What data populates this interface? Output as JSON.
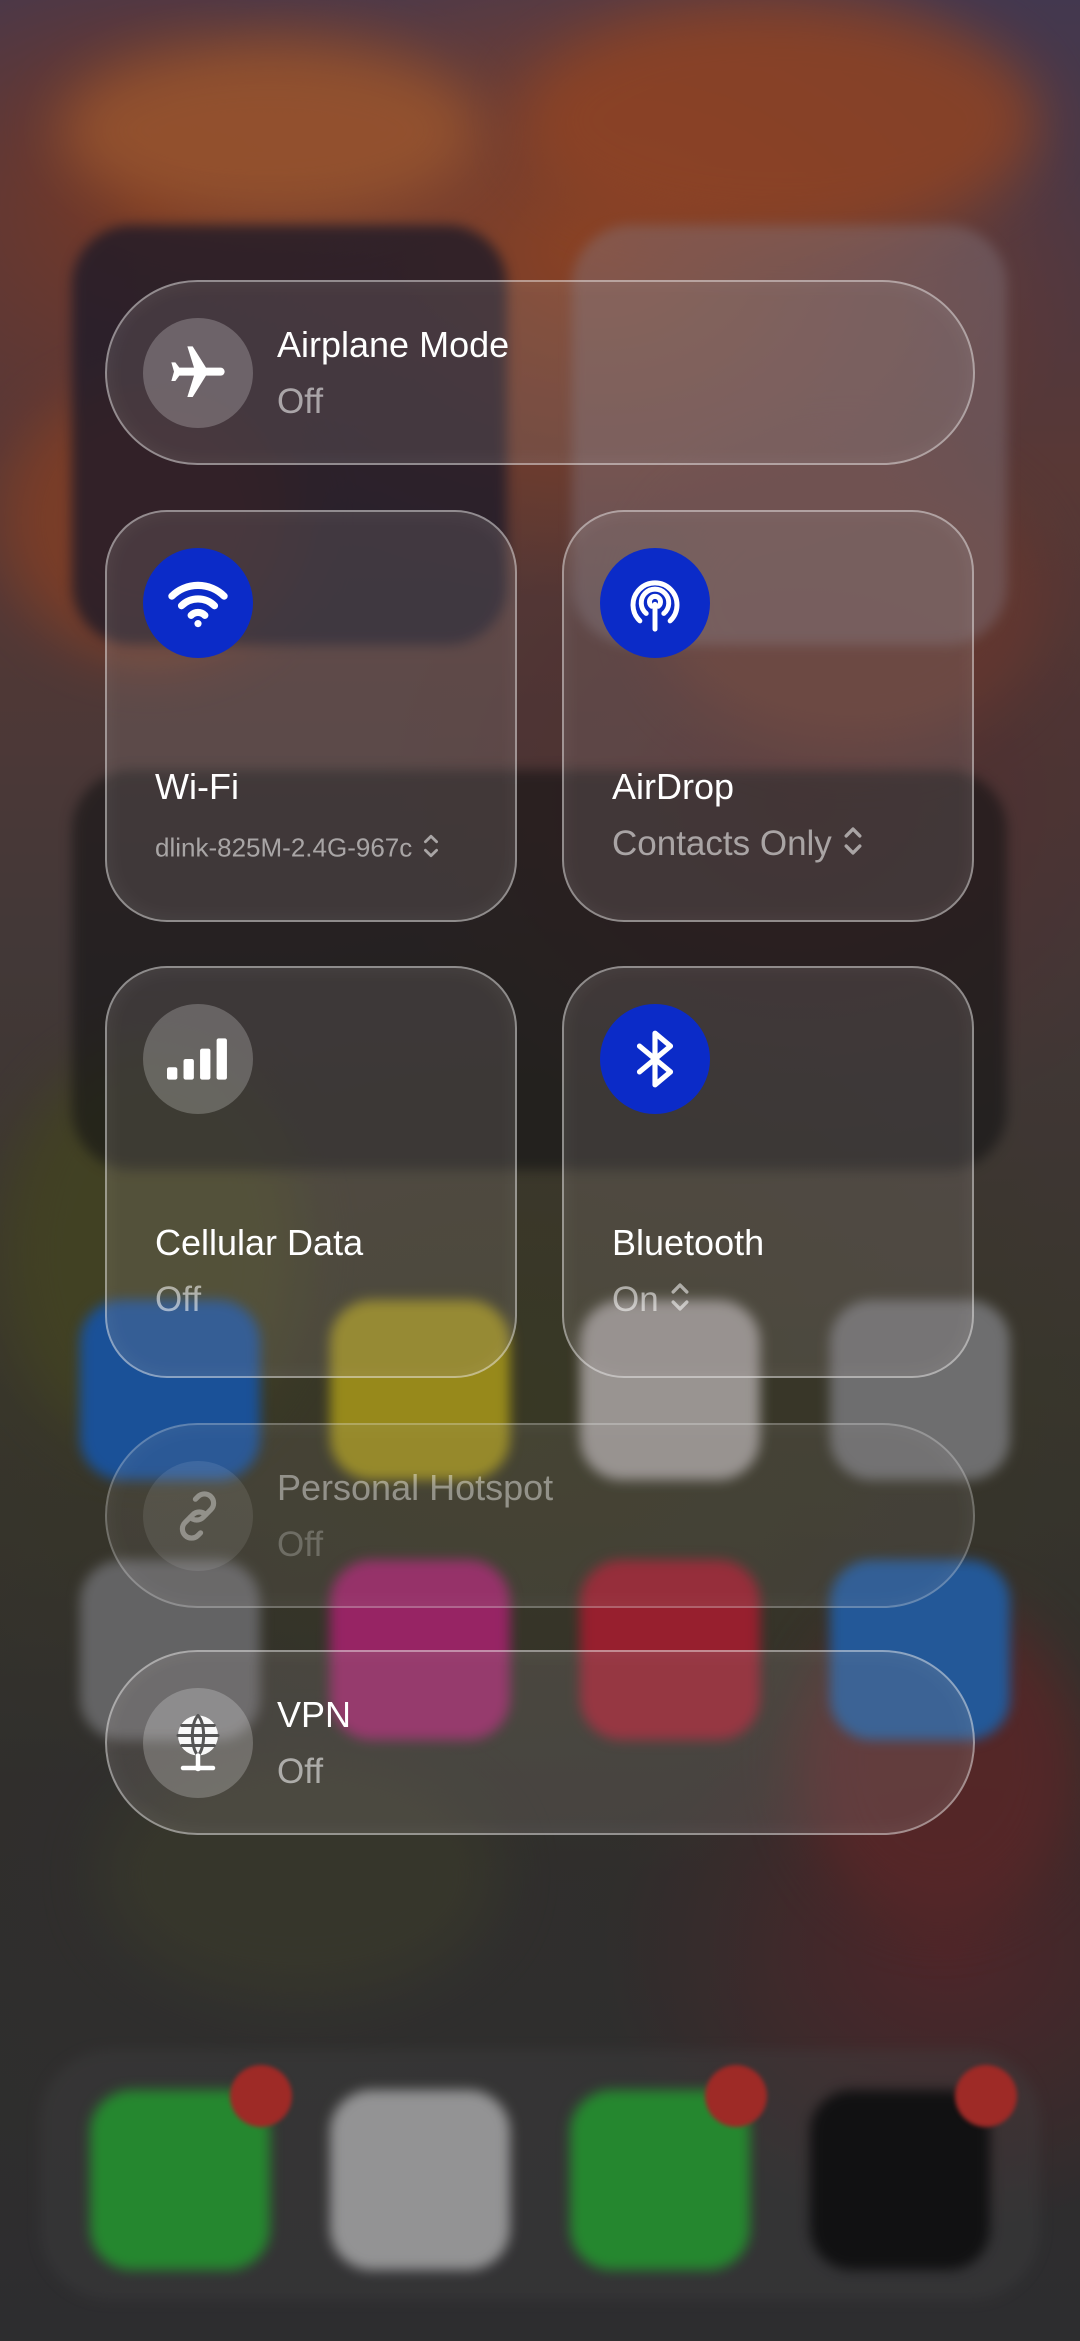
{
  "controls": {
    "airplane_mode": {
      "title": "Airplane Mode",
      "status": "Off",
      "icon": "airplane-icon"
    },
    "wifi": {
      "title": "Wi-Fi",
      "network": "dlink-825M-2.4G-967c",
      "icon": "wifi-icon",
      "active": true
    },
    "airdrop": {
      "title": "AirDrop",
      "status": "Contacts Only",
      "icon": "airdrop-icon",
      "active": true
    },
    "cellular": {
      "title": "Cellular Data",
      "status": "Off",
      "icon": "cellular-signal-icon"
    },
    "bluetooth": {
      "title": "Bluetooth",
      "status": "On",
      "icon": "bluetooth-icon",
      "active": true
    },
    "hotspot": {
      "title": "Personal Hotspot",
      "status": "Off",
      "icon": "hotspot-link-icon",
      "disabled": true
    },
    "vpn": {
      "title": "VPN",
      "status": "Off",
      "icon": "vpn-globe-icon"
    }
  },
  "colors": {
    "active_blue": "#0b2bc8",
    "badge_red": "#e0352f"
  }
}
